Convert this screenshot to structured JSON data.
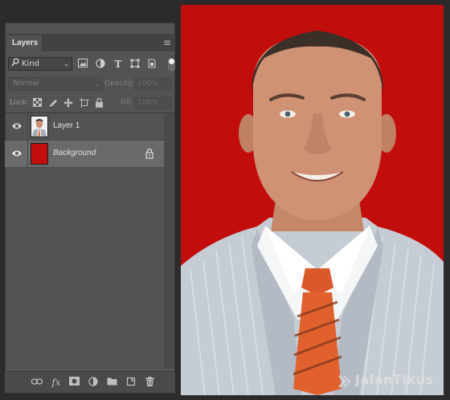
{
  "panel": {
    "tab_label": "Layers",
    "collapse_glyph": "«",
    "close_glyph": "✖",
    "menu_glyph": "≡"
  },
  "filter": {
    "kind_label": "Kind",
    "search_glyph": "⌕",
    "dropdown_glyph": "⌄",
    "icons": [
      "pixel-filter-icon",
      "adjustment-filter-icon",
      "type-filter-icon",
      "shape-filter-icon",
      "smart-object-filter-icon"
    ]
  },
  "blend": {
    "mode": "Normal",
    "opacity_label": "Opacity:",
    "opacity_value": "100%",
    "fill_label": "Fill:",
    "fill_value": "100%",
    "lock_label": "Lock:"
  },
  "layers": [
    {
      "name": "Layer 1",
      "visible": true,
      "selected": false,
      "locked": false,
      "italic": false
    },
    {
      "name": "Background",
      "visible": true,
      "selected": true,
      "locked": true,
      "italic": true
    }
  ],
  "bottom_icons": [
    "link-layers-icon",
    "fx-icon",
    "add-mask-icon",
    "new-adjustment-icon",
    "new-group-icon",
    "new-layer-icon",
    "delete-layer-icon"
  ],
  "canvas": {
    "background_color": "#c20d0d",
    "watermark": "JalanTikus"
  },
  "colors": {
    "panel_bg": "#535353",
    "selected_row": "#6a6a6a",
    "canvas_red": "#c20d0d"
  }
}
